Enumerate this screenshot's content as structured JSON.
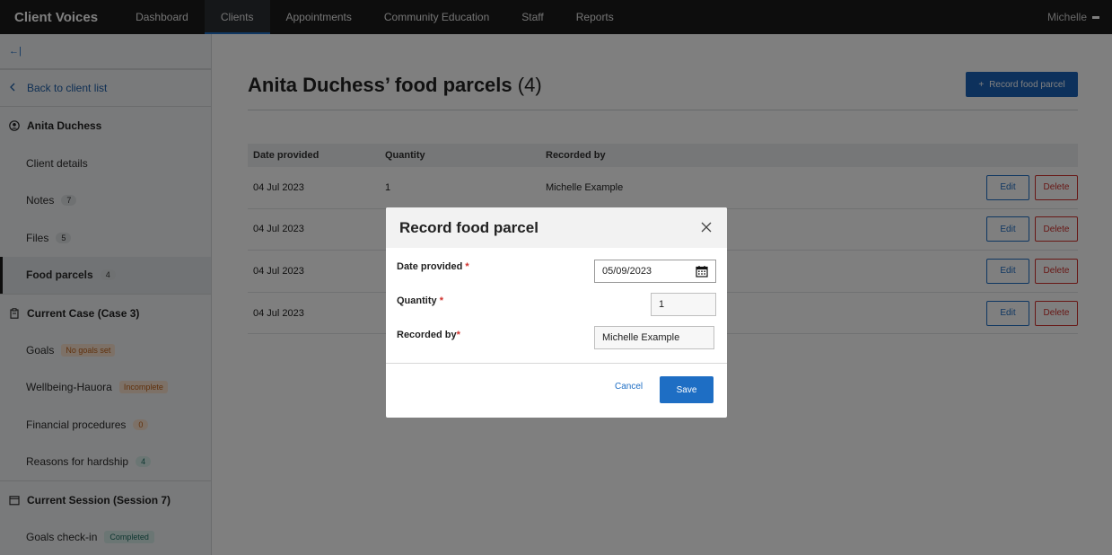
{
  "nav": {
    "brand": "Client Voices",
    "items": [
      "Dashboard",
      "Clients",
      "Appointments",
      "Community Education",
      "Staff",
      "Reports"
    ],
    "active": "Clients",
    "user": "Michelle"
  },
  "sidebar": {
    "collapse_label": "←|",
    "back_label": "Back to client list",
    "client_name": "Anita Duchess",
    "client_items": [
      {
        "label": "Client details"
      },
      {
        "label": "Notes",
        "count": "7"
      },
      {
        "label": "Files",
        "count": "5"
      },
      {
        "label": "Food parcels",
        "count": "4"
      }
    ],
    "case_title": "Current Case (Case 3)",
    "case_items": [
      {
        "label": "Goals",
        "badge": "No goals set"
      },
      {
        "label": "Wellbeing-Hauora",
        "badge": "Incomplete"
      },
      {
        "label": "Financial procedures",
        "count": "0"
      },
      {
        "label": "Reasons for hardship",
        "count": "4"
      }
    ],
    "session_title": "Current Session (Session 7)",
    "session_items": [
      {
        "label": "Goals check-in",
        "badge": "Completed"
      }
    ]
  },
  "main": {
    "title": "Anita Duchess’ food parcels",
    "title_count": "(4)",
    "record_button": "Record food parcel",
    "columns": [
      "Date provided",
      "Quantity",
      "Recorded by"
    ],
    "rows": [
      {
        "date": "04 Jul 2023",
        "quantity": "1",
        "recorded_by": "Michelle Example"
      },
      {
        "date": "04 Jul 2023",
        "quantity": "",
        "recorded_by": ""
      },
      {
        "date": "04 Jul 2023",
        "quantity": "",
        "recorded_by": ""
      },
      {
        "date": "04 Jul 2023",
        "quantity": "",
        "recorded_by": ""
      }
    ],
    "edit_label": "Edit",
    "delete_label": "Delete"
  },
  "modal": {
    "title": "Record food parcel",
    "date_label": "Date provided",
    "date_value": "05/09/2023",
    "quantity_label": "Quantity",
    "quantity_value": "1",
    "recorded_label": "Recorded by",
    "recorded_value": "Michelle Example",
    "required_mark": "*",
    "cancel_label": "Cancel",
    "save_label": "Save"
  },
  "colors": {
    "nav_bg": "#1b1b1b",
    "primary": "#1e6ec4",
    "danger": "#d0312d"
  }
}
